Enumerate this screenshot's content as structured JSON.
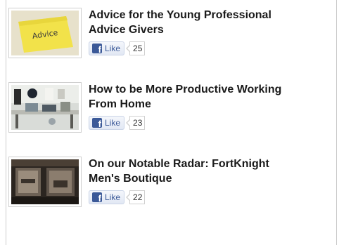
{
  "articles": [
    {
      "title": "Advice for the Young Professional Advice Givers",
      "like_label": "Like",
      "like_count": "25",
      "thumbnail": "sticky-note-advice-photo",
      "note_text": "Advice"
    },
    {
      "title": "How to be More Productive Working From Home",
      "like_label": "Like",
      "like_count": "23",
      "thumbnail": "home-office-desk-photo"
    },
    {
      "title": "On our Notable Radar: FortKnight Men's Boutique",
      "like_label": "Like",
      "like_count": "22",
      "thumbnail": "boutique-storefront-photo"
    }
  ],
  "colors": {
    "facebook_blue": "#3b5998",
    "title_text": "#1a1a1a",
    "frame_border": "#cccccc"
  }
}
